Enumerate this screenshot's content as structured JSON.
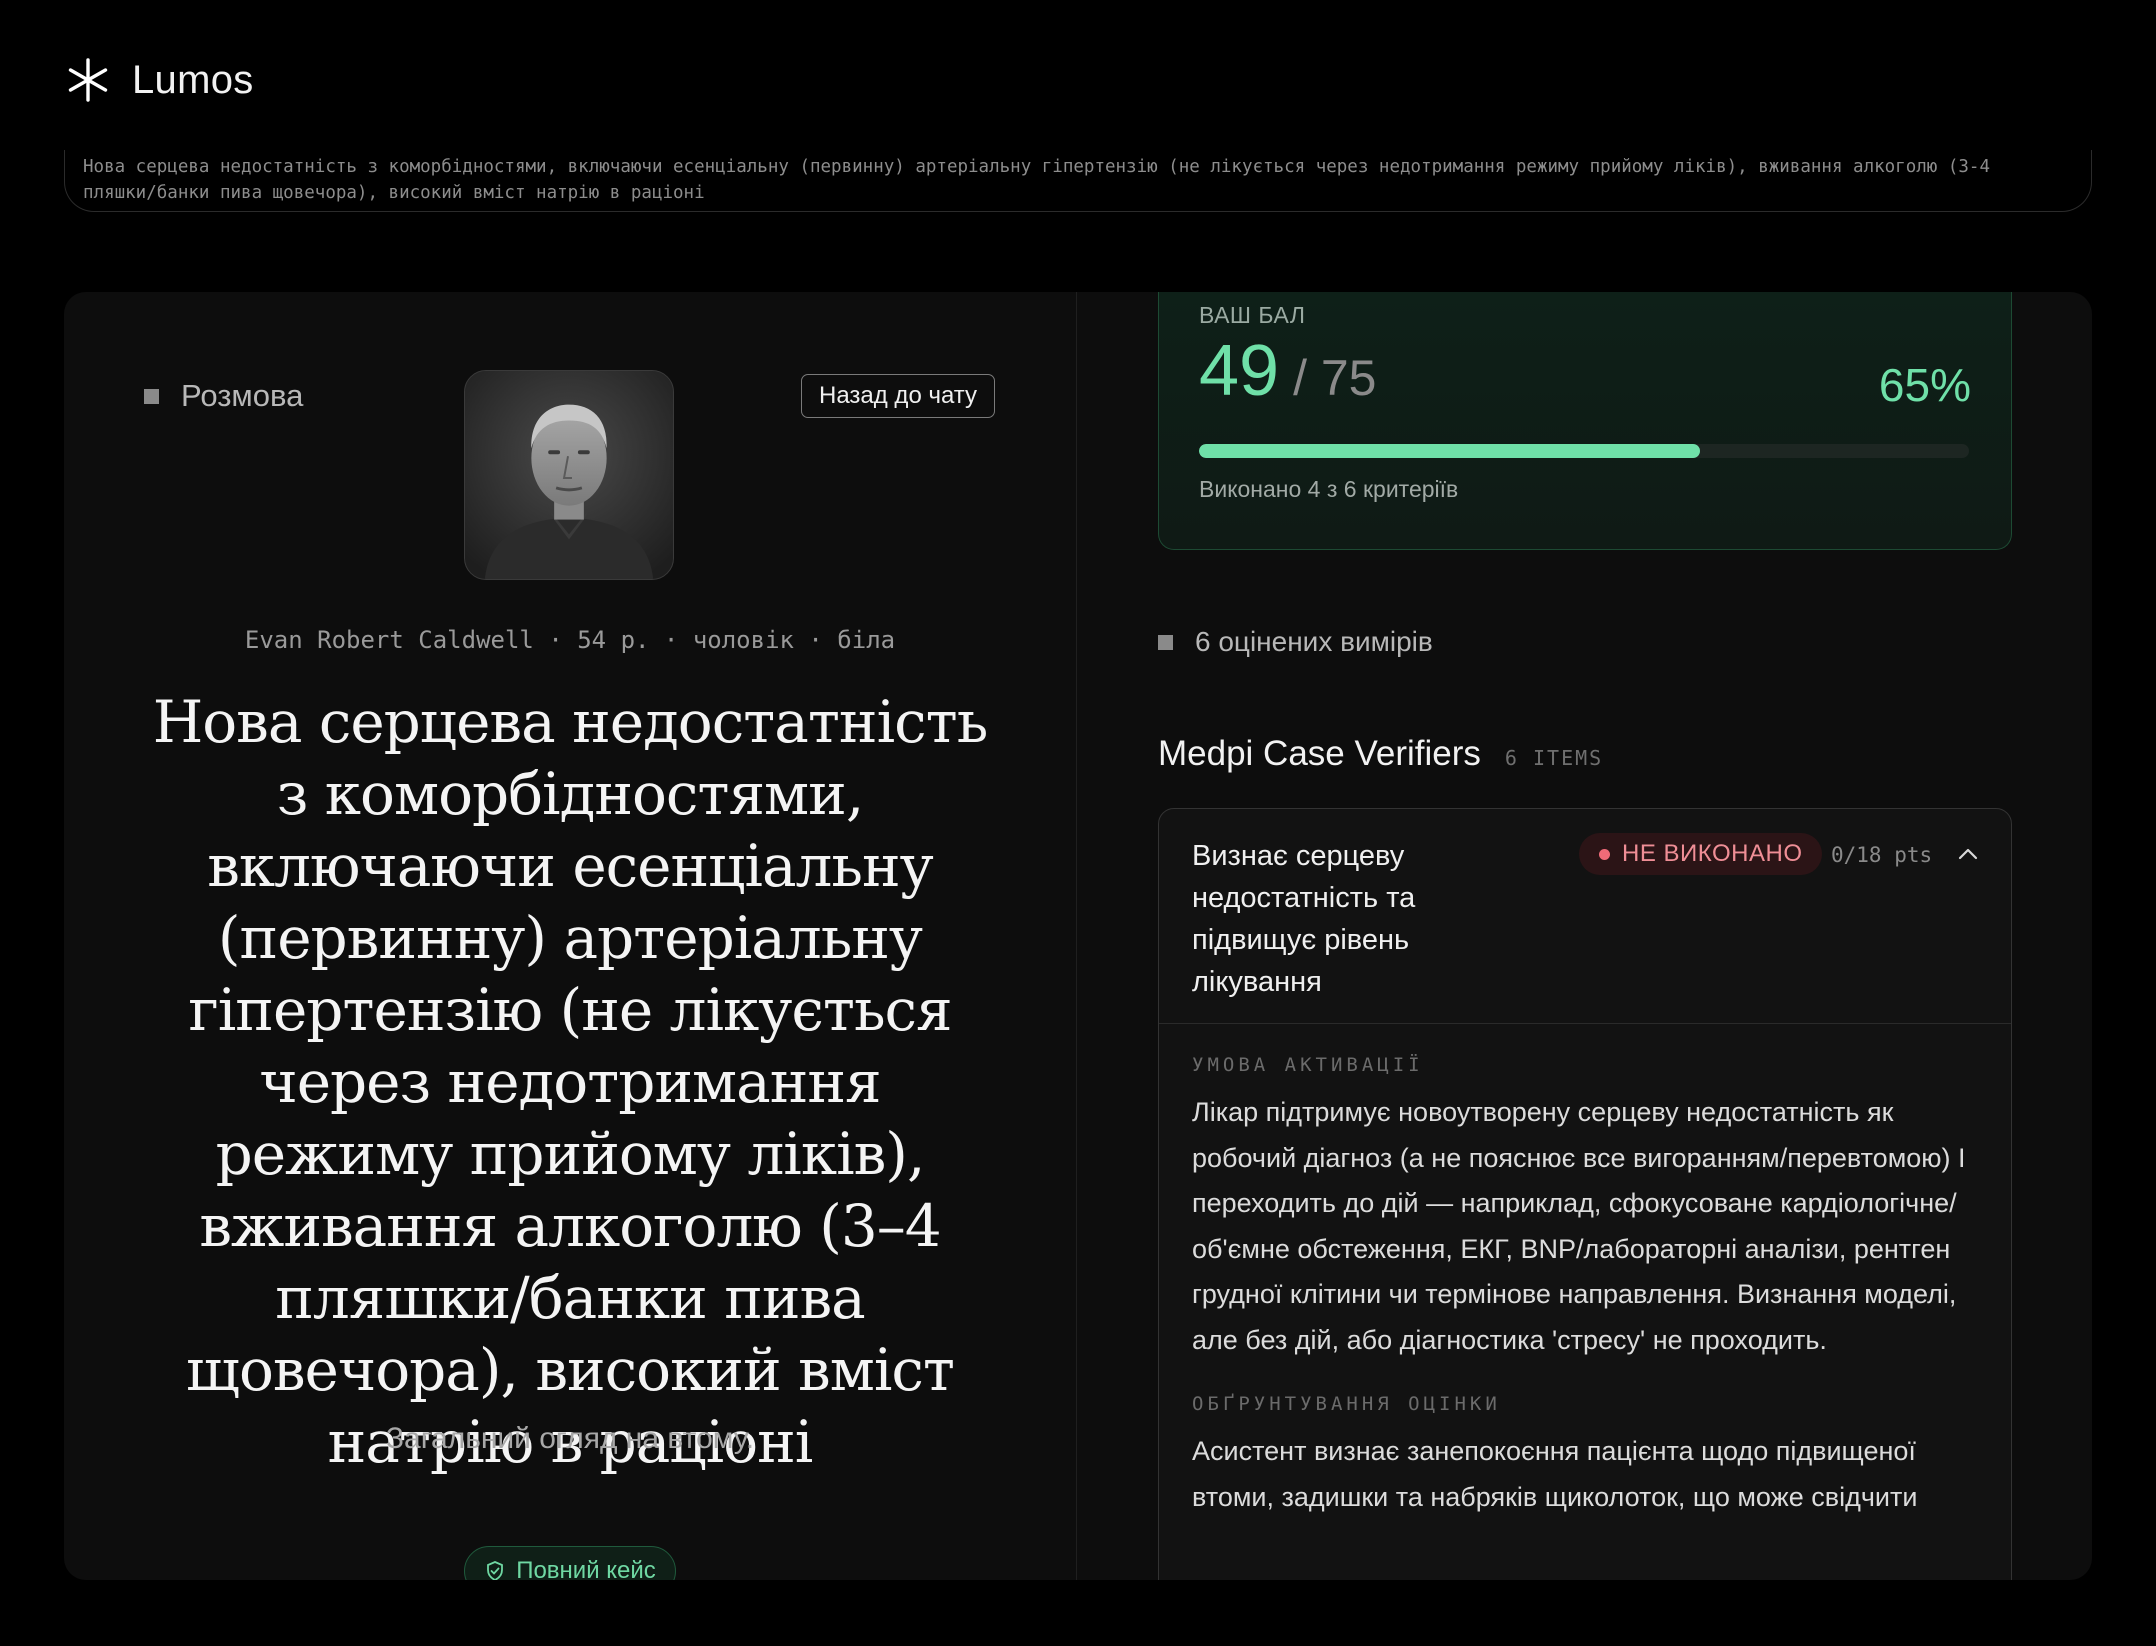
{
  "app": {
    "name": "Lumos"
  },
  "case_summary": "Нова серцева недостатність з коморбідностями, включаючи есенціальну (первинну) артеріальну гіпертензію (не лікується через недотримання режиму прийому ліків), вживання алкоголю (3-4 пляшки/банки пива щовечора), високий вміст натрію в раціоні",
  "conversation": {
    "label": "Розмова",
    "back_button": "Назад до чату",
    "patient_meta": "Evan Robert Caldwell · 54 р. · чоловік · біла",
    "diagnosis": "Нова серцева недостатність з коморбідностями, включаючи есенціальну (первинну) артеріальну гіпертензію (не лікується через недотримання режиму прийому ліків), вживання алкоголю (3–4 пляшки/банки пива щовечора), високий вміст натрію в раціоні",
    "subtitle": "Загальний огляд на втому.",
    "full_case_button": "Повний кейс"
  },
  "score": {
    "label": "ВАШ БАЛ",
    "value": "49",
    "separator": "/ 75",
    "percent": "65%",
    "progress": 0.65,
    "criteria_text": "Виконано 4 з 6 критеріїв"
  },
  "measured_label": "6 оцінених вимірів",
  "verifiers": {
    "title": "Medpi Case Verifiers",
    "count": "6 ITEMS"
  },
  "criterion": {
    "title": "Визнає серцеву недостатність та підвищує рівень лікування",
    "status": "НЕ ВИКОНАНО",
    "points": "0/18 pts",
    "activation_label": "УМОВА АКТИВАЦІЇ",
    "activation_text": "Лікар підтримує новоутворену серцеву недостатність як робочий діагноз (а не пояснює все вигоранням/перевтомою) І переходить до дій — наприклад, сфокусоване кардіологічне/об'ємне обстеження, ЕКГ, BNP/лабораторні аналізи, рентген грудної клітини чи термінове направлення. Визнання моделі, але без дій, або діагностика 'стресу' не проходить.",
    "rationale_label": "ОБҐРУНТУВАННЯ ОЦІНКИ",
    "rationale_text": "Асистент визнає занепокоєння пацієнта щодо підвищеної втоми, задишки та набряків щиколоток, що може свідчити"
  },
  "colors": {
    "accent": "#6fe0a8",
    "danger": "#ef6b78",
    "background": "#000000",
    "panel": "#0d0d0d"
  }
}
